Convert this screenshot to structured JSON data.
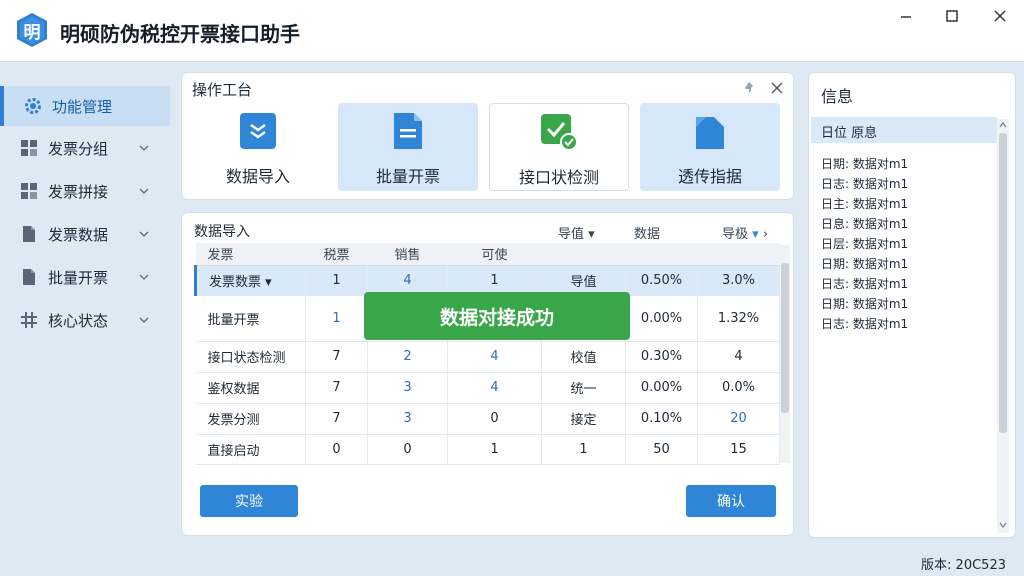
{
  "app": {
    "title": "明硕防伪税控开票接口助手",
    "logo_char": "明"
  },
  "sidebar": {
    "items": [
      {
        "label": "功能管理",
        "icon": "gear-icon",
        "active": true
      },
      {
        "label": "发票分组",
        "icon": "grid-icon"
      },
      {
        "label": "发票拼接",
        "icon": "grid-icon"
      },
      {
        "label": "发票数据",
        "icon": "document-icon"
      },
      {
        "label": "批量开票",
        "icon": "document-icon"
      },
      {
        "label": "核心状态",
        "icon": "hash-icon"
      }
    ]
  },
  "toolbox": {
    "title": "操作工台",
    "buttons": [
      {
        "label": "数据导入",
        "icon": "import-icon"
      },
      {
        "label": "批量开票",
        "icon": "file-icon"
      },
      {
        "label": "接口状检测",
        "icon": "check-icon"
      },
      {
        "label": "透传指据",
        "icon": "page-icon"
      }
    ]
  },
  "table_panel": {
    "title": "数据导入",
    "filters": [
      "导值",
      "数据",
      "导极"
    ],
    "columns": [
      "发票",
      "税票",
      "销售",
      "可使",
      "",
      "",
      ""
    ],
    "rows": [
      [
        "发票数票",
        "1",
        "4",
        "1",
        "导值",
        "0.50%",
        "3.0%"
      ],
      [
        "批量开票",
        "1",
        "",
        "",
        "",
        "0.00%",
        "1.32%"
      ],
      [
        "接口状态检测",
        "7",
        "2",
        "4",
        "校值",
        "0.30%",
        "4"
      ],
      [
        "鉴权数据",
        "7",
        "3",
        "4",
        "统一",
        "0.00%",
        "0.0%"
      ],
      [
        "发票分测",
        "7",
        "3",
        "0",
        "接定",
        "0.10%",
        "20"
      ],
      [
        "直接启动",
        "0",
        "0",
        "1",
        "1",
        "50",
        "15"
      ]
    ],
    "toast": "数据对接成功",
    "left_button": "实验",
    "right_button": "确认"
  },
  "info_panel": {
    "title": "信息",
    "header": "日位 原息",
    "log": [
      "日期: 数据对m1",
      "日志: 数据对m1",
      "日主: 数据对m1",
      "日息: 数据对m1",
      "日层: 数据对m1",
      "日期: 数据对m1",
      "日志: 数据对m1",
      "日期: 数据对m1",
      "日志: 数据对m1"
    ]
  },
  "status": {
    "version": "版本: 20C523"
  },
  "colors": {
    "accent": "#2f86d6",
    "success": "#3aa64a",
    "selected": "#d9e9f8"
  }
}
